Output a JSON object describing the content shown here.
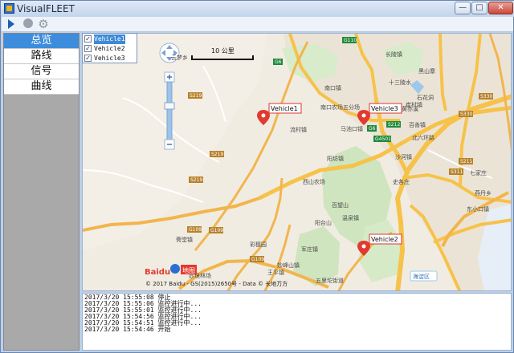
{
  "window": {
    "title": "VisualFLEET",
    "controls": {
      "minimize": "—",
      "maximize": "□",
      "close": "✕"
    }
  },
  "toolbar": {
    "icons": [
      "play-icon",
      "stop-icon",
      "gear-icon"
    ]
  },
  "sidebar": {
    "items": [
      {
        "label": "总览",
        "active": true
      },
      {
        "label": "路线",
        "active": false
      },
      {
        "label": "信号",
        "active": false
      },
      {
        "label": "曲线",
        "active": false
      }
    ]
  },
  "vehicle_list": [
    {
      "label": "Vehicle1",
      "checked": true,
      "selected": true
    },
    {
      "label": "Vehicle2",
      "checked": true,
      "selected": false
    },
    {
      "label": "Vehicle3",
      "checked": true,
      "selected": false
    }
  ],
  "map": {
    "scale_label": "10 公里",
    "copyright": "© 2017 Baidu - GS(2015)2650号 - Data © 长地万方",
    "logo_text": "Baidu",
    "logo_suffix": "地图",
    "markers": [
      {
        "label": "Vehicle1"
      },
      {
        "label": "Vehicle2"
      },
      {
        "label": "Vehicle3"
      }
    ],
    "route_badges": [
      "G110",
      "G6",
      "S212",
      "G6",
      "S219",
      "S219",
      "G109",
      "G109",
      "G109",
      "G4501",
      "S330",
      "S330",
      "S311",
      "S211",
      "S219"
    ],
    "places": [
      "长陵镇",
      "十三陵水",
      "黑山寨",
      "石花洞",
      "云梦乡",
      "南口镇",
      "黄亦溪",
      "南口农场五分场",
      "崔村镇",
      "百善镇",
      "马池口镇",
      "北六环路",
      "流村镇",
      "阳坊镇",
      "沙河镇",
      "七家庄",
      "西山农场",
      "史各庄",
      "燕丹乡",
      "温泉镇",
      "东小口镇",
      "斋堂镇",
      "彩檩园",
      "妙峰山镇",
      "王平镇",
      "军庄镇",
      "海淀区",
      "五里坨街道",
      "妙境林场",
      "百望山",
      "阳台山"
    ]
  },
  "log": {
    "lines": [
      "2017/3/20 15:55:08 停止",
      "2017/3/20 15:55:06 监控进行中...",
      "2017/3/20 15:55:01 监控进行中...",
      "2017/3/20 15:54:56 监控进行中...",
      "2017/3/20 15:54:51 监控进行中...",
      "2017/3/20 15:54:46 开始"
    ]
  },
  "colors": {
    "nav_active": "#3d8ddc",
    "marker_red": "#e23a2e",
    "highway_yellow": "#f7c24a",
    "highway_badge_green": "#1e8a3c",
    "water_blue": "#9cc8ea"
  }
}
